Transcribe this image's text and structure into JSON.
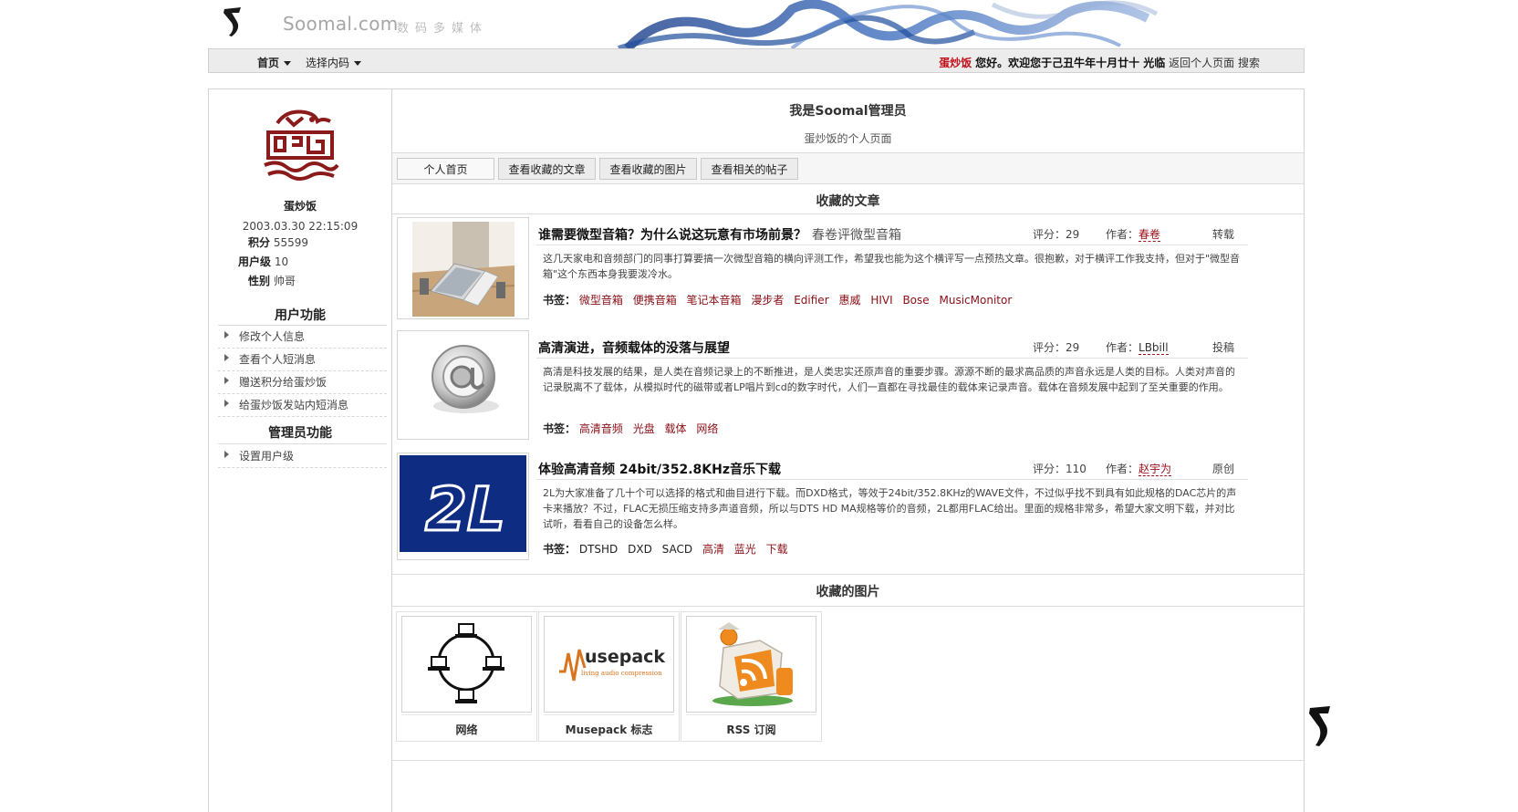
{
  "header": {
    "site_name": "Soomal.com",
    "site_sub": "数码多媒体"
  },
  "nav": {
    "home": "首页",
    "encoding": "选择内码",
    "user": "蛋炒饭",
    "greeting": "您好。欢迎您于己丑牛年十月廿十 光临",
    "back": "返回个人页面",
    "search": "搜索"
  },
  "profile": {
    "name": "蛋炒饭",
    "date": "2003.03.30 22:15:09",
    "points_label": "积分",
    "points": "55599",
    "level_label": "用户级",
    "level": "10",
    "gender_label": "性别",
    "gender": "帅哥"
  },
  "user_functions": {
    "heading": "用户功能",
    "items": [
      "修改个人信息",
      "查看个人短消息",
      "赠送积分给蛋炒饭",
      "给蛋炒饭发站内短消息"
    ]
  },
  "admin_functions": {
    "heading": "管理员功能",
    "items": [
      "设置用户级"
    ]
  },
  "main": {
    "title": "我是Soomal管理员",
    "subtitle": "蛋炒饭的个人页面",
    "tabs": [
      "个人首页",
      "查看收藏的文章",
      "查看收藏的图片",
      "查看相关的帖子"
    ],
    "articles_heading": "收藏的文章",
    "pictures_heading": "收藏的图片"
  },
  "articles": [
    {
      "title": "谁需要微型音箱？为什么说这玩意有市场前景？",
      "extra": "春卷评微型音箱",
      "score_label": "评分：",
      "score": "29",
      "author_label": "作者：",
      "author": "春卷",
      "type": "转载",
      "body": "这几天家电和音频部门的同事打算要搞一次微型音箱的横向评测工作，希望我也能为这个横评写一点预热文章。很抱歉，对于横评工作我支持，但对于\"微型音箱\"这个东西本身我要泼冷水。",
      "tags_label": "书签：",
      "tags": [
        "微型音箱",
        "便携音箱",
        "笔记本音箱",
        "漫步者",
        "Edifier",
        "惠威",
        "HIVI",
        "Bose",
        "MusicMonitor"
      ]
    },
    {
      "title": "高清演进，音频载体的没落与展望",
      "extra": "",
      "score_label": "评分：",
      "score": "29",
      "author_label": "作者：",
      "author": "LBbill",
      "type": "投稿",
      "body": "高清是科技发展的结果，是人类在音频记录上的不断推进，是人类忠实还原声音的重要步骤。源源不断的最求高品质的声音永远是人类的目标。人类对声音的记录脱离不了载体，从模拟时代的磁带或者LP唱片到cd的数字时代，人们一直都在寻找最佳的载体来记录声音。载体在音频发展中起到了至关重要的作用。",
      "tags_label": "书签：",
      "tags": [
        "高清音频",
        "光盘",
        "载体",
        "网络"
      ]
    },
    {
      "title": "体验高清音频 24bit/352.8KHz音乐下载",
      "extra": "",
      "score_label": "评分：",
      "score": "110",
      "author_label": "作者：",
      "author": "赵宇为",
      "type": "原创",
      "body": "2L为大家准备了几十个可以选择的格式和曲目进行下载。而DXD格式，等效于24bit/352.8KHz的WAVE文件，不过似乎找不到具有如此规格的DAC芯片的声卡来播放？不过，FLAC无损压缩支持多声道音频，所以与DTS HD MA规格等价的音频，2L都用FLAC给出。里面的规格非常多，希望大家文明下载，并对比试听，看看自己的设备怎么样。",
      "tags_label": "书签：",
      "tags": [
        "DTSHD",
        "DXD",
        "SACD",
        "高清",
        "蓝光",
        "下载"
      ]
    }
  ],
  "pictures": [
    {
      "caption": "网络"
    },
    {
      "caption": "Musepack 标志",
      "logo_text": "usepack",
      "logo_sub": "living audio compression"
    },
    {
      "caption": "RSS 订阅"
    }
  ],
  "colors": {
    "accent_red": "#a0101a",
    "smoke_blue": "#1f4f9c",
    "tile_blue": "#0e2c82",
    "musepack_orange": "#d9731c"
  }
}
